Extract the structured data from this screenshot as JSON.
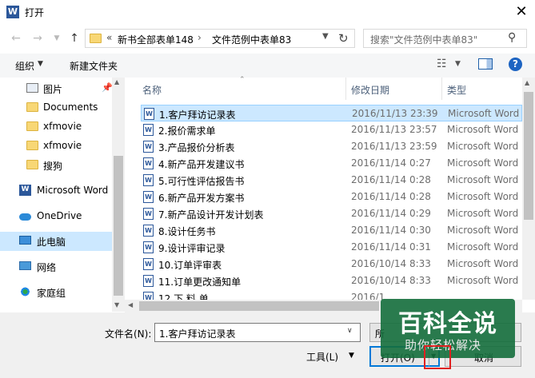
{
  "window": {
    "title": "打开",
    "app_icon_letter": "W"
  },
  "address": {
    "chevrons": "«",
    "crumb1": "新书全部表单148",
    "separator": "›",
    "crumb2": "文件范例中表单83"
  },
  "search": {
    "placeholder": "搜索\"文件范例中表单83\""
  },
  "toolbar": {
    "organize_label": "组织",
    "new_folder_label": "新建文件夹",
    "help_label": "?"
  },
  "nav": {
    "items": [
      {
        "label": "图片",
        "icon": "pictures-icon"
      },
      {
        "label": "Documents",
        "icon": "folder-icon"
      },
      {
        "label": "xfmovie",
        "icon": "folder-icon"
      },
      {
        "label": "xfmovie",
        "icon": "folder-icon"
      },
      {
        "label": "搜狗",
        "icon": "folder-icon"
      },
      {
        "label": "Microsoft Word",
        "icon": "word-icon"
      },
      {
        "label": "OneDrive",
        "icon": "onedrive-icon"
      },
      {
        "label": "此电脑",
        "icon": "computer-icon"
      },
      {
        "label": "网络",
        "icon": "network-icon"
      },
      {
        "label": "家庭组",
        "icon": "homegroup-icon"
      }
    ]
  },
  "columns": {
    "name": "名称",
    "modified": "修改日期",
    "type": "类型"
  },
  "files": [
    {
      "name": "1.客户拜访记录表",
      "date": "2016/11/13 23:39",
      "type": "Microsoft Word"
    },
    {
      "name": "2.报价需求单",
      "date": "2016/11/13 23:57",
      "type": "Microsoft Word"
    },
    {
      "name": "3.产品报价分析表",
      "date": "2016/11/13 23:59",
      "type": "Microsoft Word"
    },
    {
      "name": "4.新产品开发建议书",
      "date": "2016/11/14 0:27",
      "type": "Microsoft Word"
    },
    {
      "name": "5.可行性评估报告书",
      "date": "2016/11/14 0:28",
      "type": "Microsoft Word"
    },
    {
      "name": "6.新产品开发方案书",
      "date": "2016/11/14 0:28",
      "type": "Microsoft Word"
    },
    {
      "name": "7.新产品设计开发计划表",
      "date": "2016/11/14 0:29",
      "type": "Microsoft Word"
    },
    {
      "name": "8.设计任务书",
      "date": "2016/11/14 0:30",
      "type": "Microsoft Word"
    },
    {
      "name": "9.设计评审记录",
      "date": "2016/11/14 0:31",
      "type": "Microsoft Word"
    },
    {
      "name": "10.订单评审表",
      "date": "2016/10/14 8:33",
      "type": "Microsoft Word"
    },
    {
      "name": "11.订单更改通知单",
      "date": "2016/10/14 8:33",
      "type": "Microsoft Word"
    },
    {
      "name": "12.下 料 单",
      "date": "2016/1",
      "type": ""
    }
  ],
  "bottom": {
    "filename_label": "文件名(N):",
    "filename_value": "1.客户拜访记录表",
    "type_value": "所",
    "tools_label": "工具(L)",
    "open_label": "打开(O)",
    "cancel_label": "取消"
  },
  "watermark": {
    "title": "百科全说",
    "subtitle": "助你轻松解决"
  }
}
